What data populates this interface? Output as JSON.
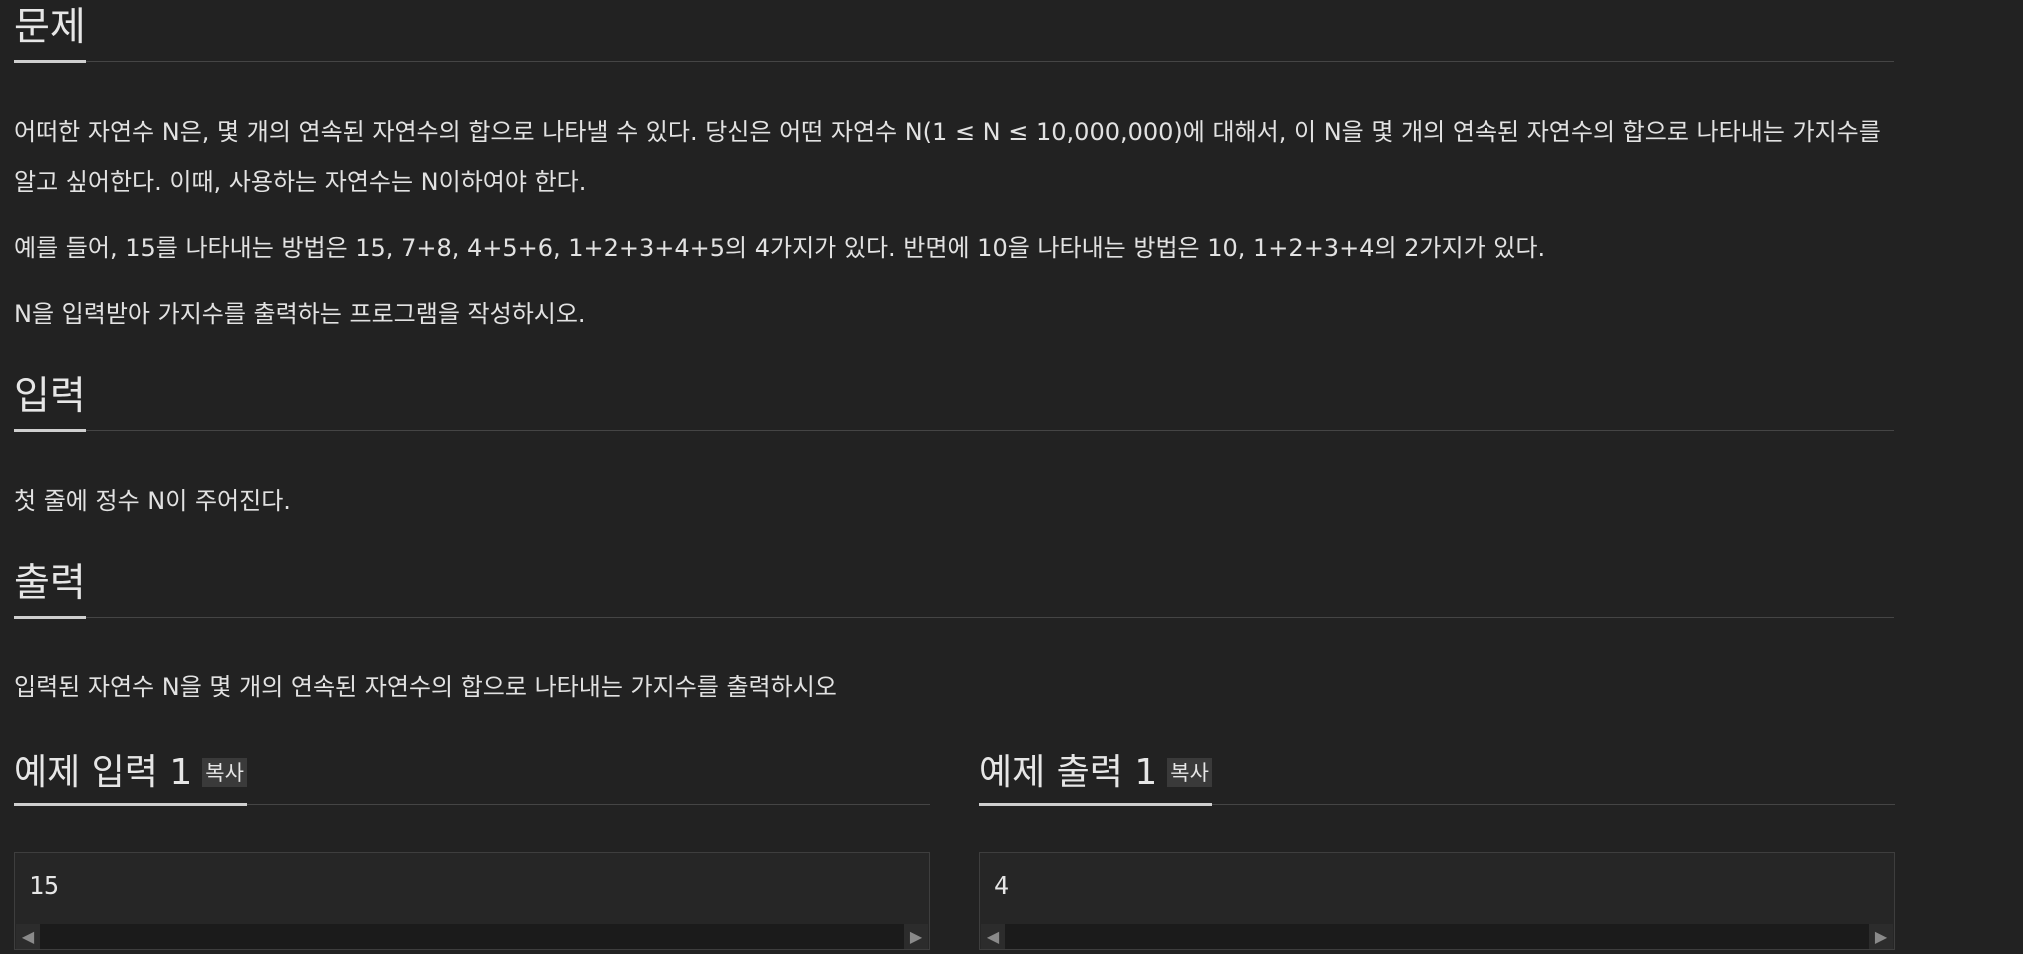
{
  "problem": {
    "title": "문제",
    "paragraphs": [
      "어떠한 자연수 N은, 몇 개의 연속된 자연수의 합으로 나타낼 수 있다. 당신은 어떤 자연수 N(1 ≤ N ≤ 10,000,000)에 대해서, 이 N을 몇 개의 연속된 자연수의 합으로 나타내는 가지수를 알고 싶어한다. 이때, 사용하는 자연수는 N이하여야 한다.",
      "예를 들어, 15를 나타내는 방법은 15, 7+8, 4+5+6, 1+2+3+4+5의 4가지가 있다. 반면에 10을 나타내는 방법은 10, 1+2+3+4의 2가지가 있다.",
      "N을 입력받아 가지수를 출력하는 프로그램을 작성하시오."
    ]
  },
  "input": {
    "title": "입력",
    "text": "첫 줄에 정수 N이 주어진다."
  },
  "output": {
    "title": "출력",
    "text": "입력된 자연수 N을 몇 개의 연속된 자연수의 합으로 나타내는 가지수를 출력하시오"
  },
  "sample_input": {
    "title": "예제 입력 1",
    "copy_label": "복사",
    "value": "15"
  },
  "sample_output": {
    "title": "예제 출력 1",
    "copy_label": "복사",
    "value": "4"
  },
  "icons": {
    "scroll_left": "scroll-left-arrow-icon",
    "scroll_right": "scroll-right-arrow-icon"
  }
}
